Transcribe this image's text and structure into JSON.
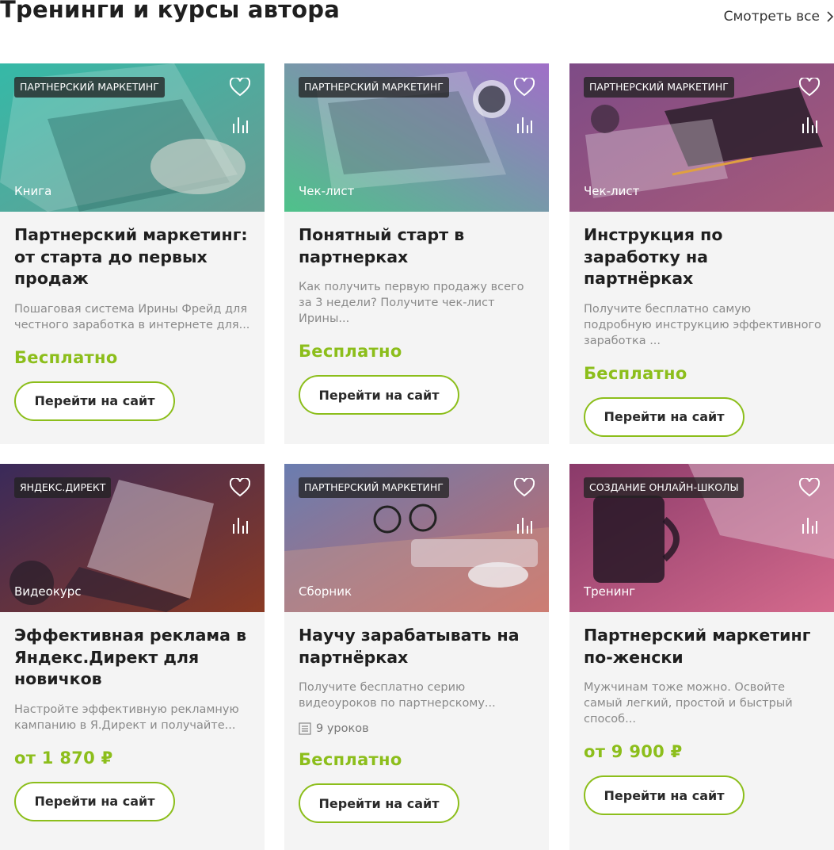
{
  "header": {
    "title": "Тренинги и курсы автора",
    "see_all_label": "Смотреть все"
  },
  "cards": [
    {
      "category": "ПАРТНЕРСКИЙ МАРКЕТИНГ",
      "type": "Книга",
      "title": "Партнерский маркетинг: от старта до первых продаж",
      "description": "Пошаговая система Ирины Фрейд для честного заработка в интернете для...",
      "price": "Бесплатно",
      "button_label": "Перейти на сайт",
      "gradient": [
        "#2fb4a3",
        "#6c9a8b"
      ]
    },
    {
      "category": "ПАРТНЕРСКИЙ МАРКЕТИНГ",
      "type": "Чек-лист",
      "title": "Понятный старт в партнерках",
      "description": "Как получить первую продажу всего за 3 недели? Получите чек-лист Ирины...",
      "price": "Бесплатно",
      "button_label": "Перейти на сайт",
      "gradient": [
        "#4fc08a",
        "#9a6fc4"
      ]
    },
    {
      "category": "ПАРТНЕРСКИЙ МАРКЕТИНГ",
      "type": "Чек-лист",
      "title": "Инструкция по заработку на партнёрках",
      "description": "Получите бесплатно самую подробную инструкцию эффективного заработка ...",
      "price": "Бесплатно",
      "button_label": "Перейти на сайт",
      "gradient": [
        "#8a4f8a",
        "#a35a78"
      ]
    },
    {
      "category": "ЯНДЕКС.ДИРЕКТ",
      "type": "Видеокурс",
      "title": "Эффективная реклама в Яндекс.Директ для новичков",
      "description": "Настройте эффективную рекламную кампанию в Я.Директ и получайте...",
      "price": "от 1 870 ₽",
      "button_label": "Перейти на сайт",
      "gradient": [
        "#3a2a5a",
        "#8a3a2a"
      ]
    },
    {
      "category": "ПАРТНЕРСКИЙ МАРКЕТИНГ",
      "type": "Сборник",
      "title": "Научу зарабатывать на партнёрках",
      "description": "Получите бесплатно серию видеоуроков по партнерскому...",
      "lessons": "9 уроков",
      "price": "Бесплатно",
      "button_label": "Перейти на сайт",
      "gradient": [
        "#6a7aa8",
        "#c46a6a"
      ]
    },
    {
      "category": "СОЗДАНИЕ ОНЛАЙН-ШКОЛЫ",
      "type": "Тренинг",
      "title": "Партнерский маркетинг по-женски",
      "description": "Мужчинам тоже можно. Освойте самый легкий, простой и быстрый способ...",
      "price": "от 9 900 ₽",
      "button_label": "Перейти на сайт",
      "gradient": [
        "#8a3a6a",
        "#d06a8a"
      ]
    }
  ]
}
